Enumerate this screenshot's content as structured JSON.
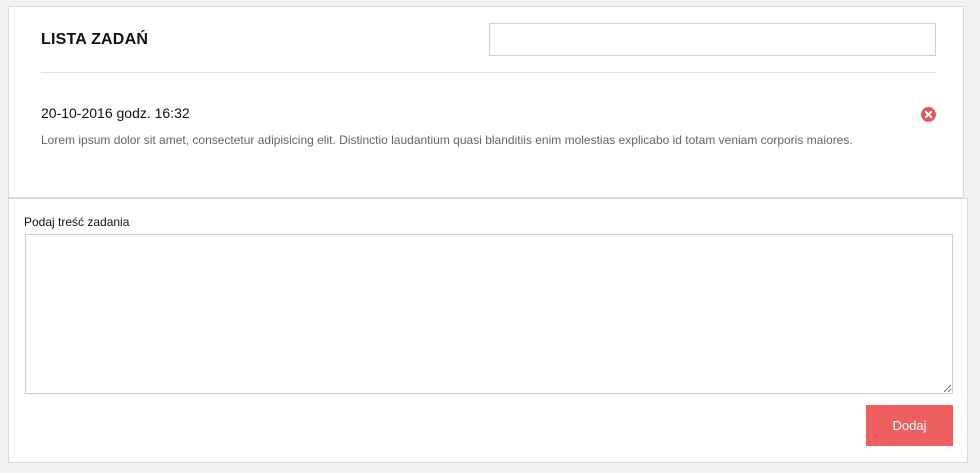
{
  "list": {
    "title": "LISTA ZADAŃ",
    "search_value": "",
    "search_placeholder": "",
    "tasks": [
      {
        "date": "20-10-2016 godz. 16:32",
        "text": "Lorem ipsum dolor sit amet, consectetur adipisicing elit. Distinctio laudantium quasi blanditiis enim molestias explicabo id totam veniam corporis maiores.",
        "delete_icon": "close-circle-icon"
      }
    ]
  },
  "form": {
    "label": "Podaj treść zadania",
    "textarea_value": "",
    "add_button_label": "Dodaj"
  },
  "colors": {
    "accent": "#ef5f5f",
    "delete_icon": "#e05a5a"
  }
}
